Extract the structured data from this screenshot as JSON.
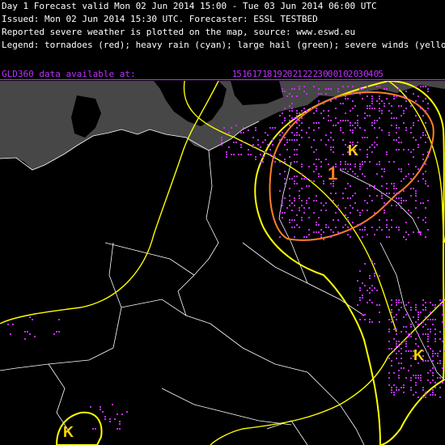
{
  "header": {
    "line1": "Day 1 Forecast valid Mon 02 Jun 2014 15:00 - Tue 03 Jun 2014 06:00 UTC",
    "line2": "Issued: Mon 02 Jun 2014 15:30 UTC. Forecaster: ESSL TESTBED",
    "line3": "Reported severe weather is plotted on the map, source: www.eswd.eu",
    "line4": "Legend: tornadoes (red); heavy rain (cyan); large hail (green); severe winds (yellow)"
  },
  "lightning": {
    "label": "GLD360 data available at:",
    "hours": [
      "15",
      "16",
      "17",
      "18",
      "19",
      "20",
      "21",
      "22",
      "23",
      "00",
      "01",
      "02",
      "03",
      "04",
      "05"
    ]
  },
  "map": {
    "colors": {
      "sea": "#000000",
      "land": "#000000",
      "dark_area": "#474747",
      "borders": "#ffffff",
      "level_1": "#ffff00",
      "level_2": "#ff7f27",
      "lightning": "#c030ff",
      "wind_report": "#ffd700"
    },
    "level_label": "1",
    "report_symbol": "K"
  }
}
